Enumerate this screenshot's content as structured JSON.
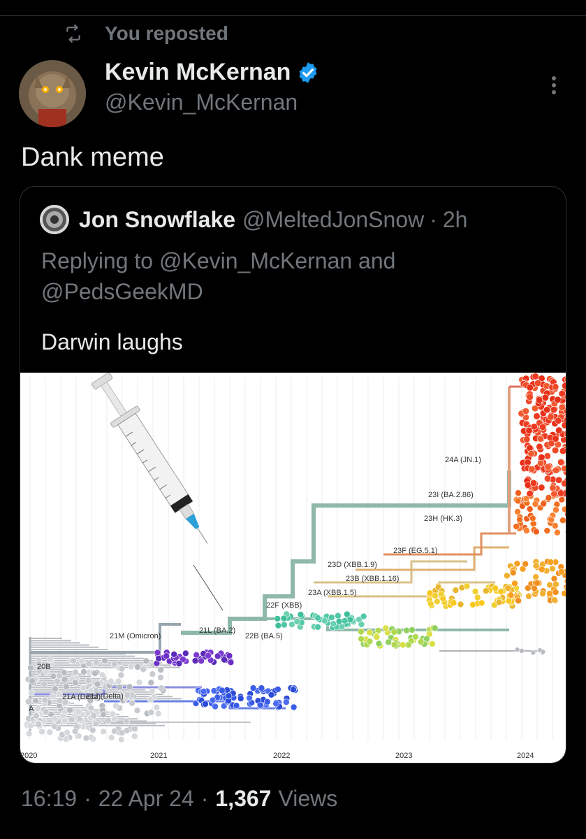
{
  "repost": {
    "label": "You reposted",
    "icon": "repost-icon"
  },
  "author": {
    "name": "Kevin McKernan",
    "handle": "@Kevin_McKernan",
    "verified_icon": "verified-badge-icon",
    "verified_color": "#1d9bf0"
  },
  "tweet": {
    "text": "Dank meme"
  },
  "quoted": {
    "name": "Jon Snowflake",
    "handle": "@MeltedJonSnow",
    "separator": "·",
    "time": "2h",
    "reply_line1": "Replying to @Kevin_McKernan and",
    "reply_line2": "@PedsGeekMD",
    "text": "Darwin laughs"
  },
  "image": {
    "x_ticks": [
      "2020",
      "2021",
      "2022",
      "2023",
      "2024"
    ],
    "clade_labels": [
      "24A (JN.1)",
      "23I (BA.2.86)",
      "23H (HK.3)",
      "23F (EG.5.1)",
      "23D (XBB.1.9)",
      "23B (XBB.1.16)",
      "23A (XBB.1.5)",
      "22F (XBB)",
      "21L (BA.2)",
      "22B (BA.5)",
      "21M (Omicron)",
      "20B",
      "21A (Delta)",
      "21J (Delta)",
      "A"
    ]
  },
  "footer": {
    "time": "16:19",
    "sep1": "·",
    "date": "22 Apr 24",
    "sep2": "·",
    "views_count": "1,367",
    "views_label": "Views"
  },
  "colors": {
    "background": "#000000",
    "text": "#e7e9ea",
    "muted": "#71767b",
    "border": "#2f3336",
    "accent": "#1d9bf0"
  }
}
